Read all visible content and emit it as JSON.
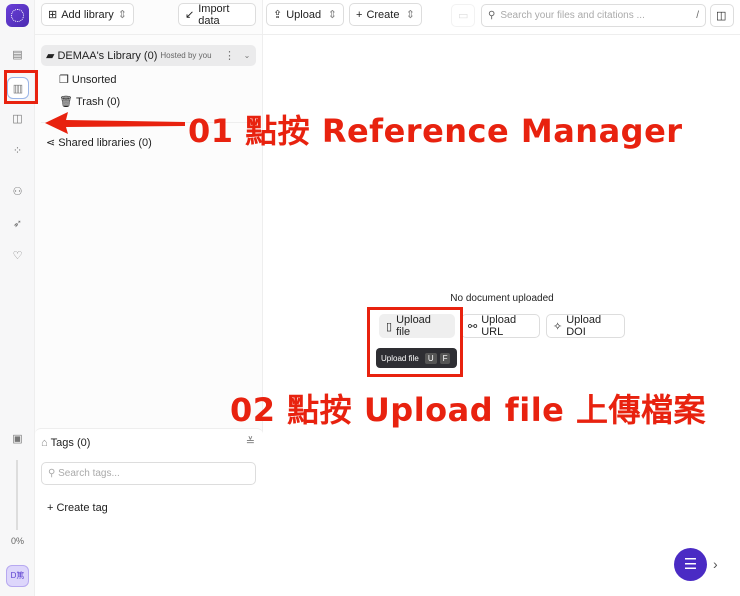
{
  "rail": {
    "items": [
      "documents",
      "reference-manager",
      "chat",
      "apps",
      "users",
      "rocket",
      "plugin",
      "media"
    ],
    "progress": "0%",
    "avatar": "D篤"
  },
  "toolbar": {
    "add_library": "Add library",
    "import_data": "Import data",
    "upload": "Upload",
    "create": "Create",
    "search_placeholder": "Search your files and citations ...",
    "search_shortcut": "/"
  },
  "sidebar": {
    "library_name": "DEMAA's Library (0)",
    "library_hosted": "Hosted by you",
    "unsorted": "Unsorted",
    "trash": "Trash (0)",
    "shared": "Shared libraries (0)",
    "tags_title": "Tags (0)",
    "tags_placeholder": "Search tags...",
    "create_tag": "Create tag"
  },
  "main": {
    "empty": "No document uploaded",
    "upload_file": "Upload file",
    "upload_url": "Upload URL",
    "upload_doi": "Upload DOI",
    "tooltip": {
      "label": "Upload file",
      "keys": [
        "U",
        "F"
      ]
    }
  },
  "annotations": {
    "step1": "01 點按 Reference Manager",
    "step2": "02 點按 Upload file 上傳檔案"
  },
  "colors": {
    "accent": "#4a2bc4",
    "annotation": "#e8220f"
  }
}
